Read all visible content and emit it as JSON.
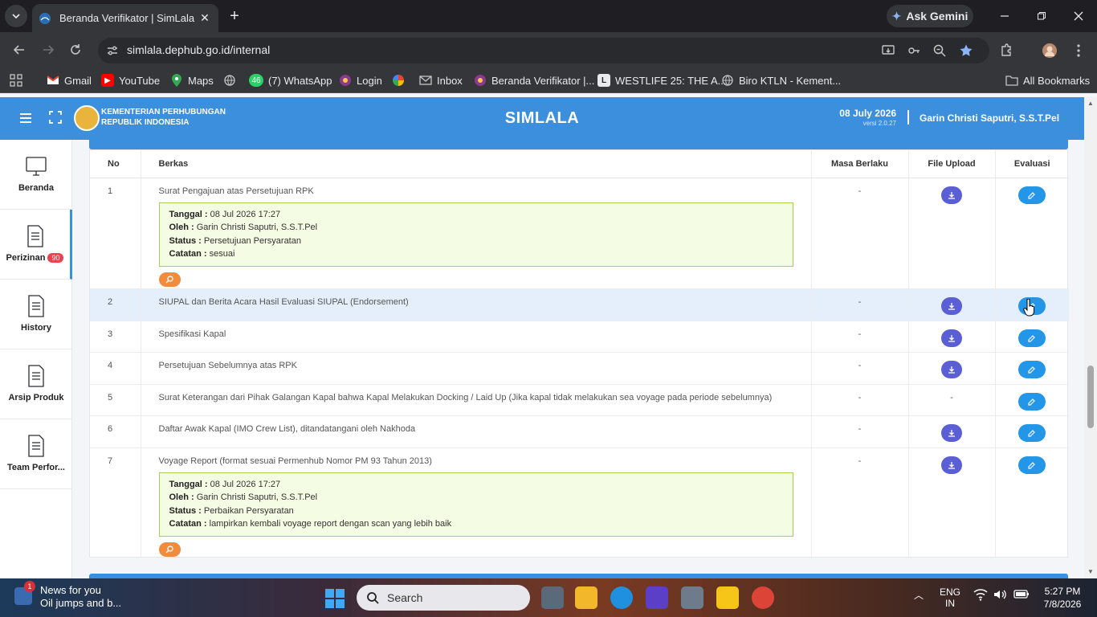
{
  "browser": {
    "tab_title": "Beranda Verifikator | SimLala",
    "url": "simlala.dephub.go.id/internal",
    "gemini_label": "Ask Gemini",
    "bookmarks": [
      {
        "label": "Gmail"
      },
      {
        "label": "YouTube"
      },
      {
        "label": "Maps"
      },
      {
        "label": ""
      },
      {
        "label": "(7) WhatsApp",
        "badge": "46"
      },
      {
        "label": "Login"
      },
      {
        "label": ""
      },
      {
        "label": "Inbox"
      },
      {
        "label": "Beranda Verifikator |..."
      },
      {
        "label": "WESTLIFE 25: THE A..."
      },
      {
        "label": "Biro KTLN - Kement..."
      }
    ],
    "all_bookmarks": "All Bookmarks"
  },
  "header": {
    "ministry_line1": "KEMENTERIAN PERHUBUNGAN",
    "ministry_line2": "REPUBLIK INDONESIA",
    "app_title": "SIMLALA",
    "date": "08 July 2026",
    "version": "versi 2.0.27",
    "user": "Garin Christi Saputri, S.S.T.Pel"
  },
  "sidebar": {
    "items": [
      {
        "label": "Beranda"
      },
      {
        "label": "Perizinan",
        "badge": "90"
      },
      {
        "label": "History"
      },
      {
        "label": "Arsip Produk"
      },
      {
        "label": "Team Perfor..."
      }
    ]
  },
  "table": {
    "headers": {
      "no": "No",
      "berkas": "Berkas",
      "masa": "Masa Berlaku",
      "file": "File Upload",
      "eval": "Evaluasi"
    },
    "note_labels": {
      "tanggal": "Tanggal :",
      "oleh": "Oleh :",
      "status": "Status :",
      "catatan": "Catatan :"
    },
    "rows": [
      {
        "no": "1",
        "berkas": "Surat Pengajuan atas Persetujuan RPK",
        "masa": "-",
        "note": {
          "tanggal": "08 Jul 2026 17:27",
          "oleh": "Garin Christi Saputri, S.S.T.Pel",
          "status": "Persetujuan Persyaratan",
          "catatan": "sesuai"
        }
      },
      {
        "no": "2",
        "berkas": "SIUPAL dan Berita Acara Hasil Evaluasi SIUPAL (Endorsement)",
        "masa": "-"
      },
      {
        "no": "3",
        "berkas": "Spesifikasi Kapal",
        "masa": "-"
      },
      {
        "no": "4",
        "berkas": "Persetujuan Sebelumnya atas RPK",
        "masa": "-"
      },
      {
        "no": "5",
        "berkas": "Surat Keterangan dari Pihak Galangan Kapal bahwa Kapal Melakukan Docking / Laid Up (Jika kapal tidak melakukan sea voyage pada periode sebelumnya)",
        "masa": "-",
        "file_text": "-"
      },
      {
        "no": "6",
        "berkas": "Daftar Awak Kapal (IMO Crew List), ditandatangani oleh Nakhoda",
        "masa": "-"
      },
      {
        "no": "7",
        "berkas": "Voyage Report (format sesuai Permenhub Nomor PM 93 Tahun 2013)",
        "masa": "-",
        "note": {
          "tanggal": "08 Jul 2026 17:27",
          "oleh": "Garin Christi Saputri, S.S.T.Pel",
          "status": "Perbaikan Persyaratan",
          "catatan": "lampirkan kembali voyage report dengan scan yang lebih baik"
        }
      }
    ]
  },
  "taskbar": {
    "news_title": "News for you",
    "news_sub": "Oil jumps and b...",
    "news_badge": "1",
    "search_label": "Search",
    "lang1": "ENG",
    "lang2": "IN",
    "time": "5:27 PM",
    "date": "7/8/2026"
  }
}
